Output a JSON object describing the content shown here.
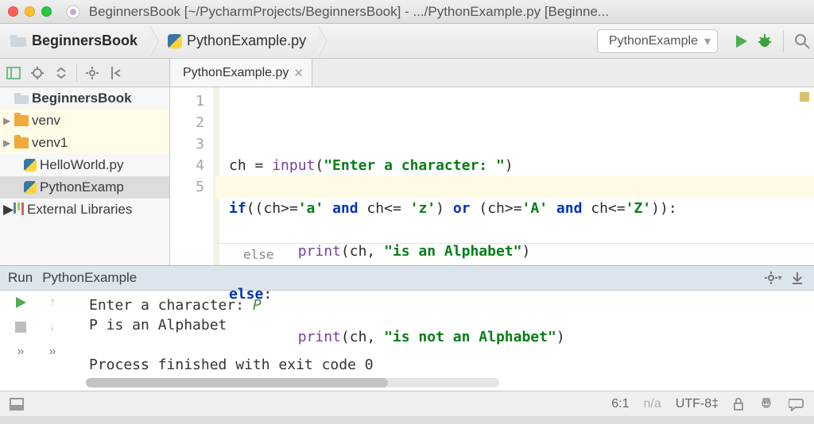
{
  "window": {
    "title": "BeginnersBook [~/PycharmProjects/BeginnersBook] - .../PythonExample.py [Beginne..."
  },
  "breadcrumbs": {
    "root": "BeginnersBook",
    "file": "PythonExample.py"
  },
  "run_config": {
    "name": "PythonExample"
  },
  "tab": {
    "label": "PythonExample.py"
  },
  "tree": {
    "project": "BeginnersBook",
    "items": [
      {
        "label": "venv",
        "kind": "dir"
      },
      {
        "label": "venv1",
        "kind": "dir"
      },
      {
        "label": "HelloWorld.py",
        "kind": "py"
      },
      {
        "label": "PythonExamp",
        "kind": "py",
        "selected": true
      }
    ],
    "external": "External Libraries"
  },
  "editor": {
    "line_numbers": [
      "1",
      "2",
      "3",
      "4",
      "5"
    ],
    "code": {
      "l1_a": "ch = ",
      "l1_fn": "input",
      "l1_b": "(",
      "l1_str": "\"Enter a character: \"",
      "l1_c": ")",
      "l2_kw1": "if",
      "l2_a": "((ch>=",
      "l2_s1": "'a'",
      "l2_b": " ",
      "l2_kw2": "and",
      "l2_c": " ch<= ",
      "l2_s2": "'z'",
      "l2_d": ") ",
      "l2_kw3": "or",
      "l2_e": " (ch>=",
      "l2_s3": "'A'",
      "l2_f": " ",
      "l2_kw4": "and",
      "l2_g": " ch<=",
      "l2_s4": "'Z'",
      "l2_h": ")):",
      "l3_a": "        ",
      "l3_fn": "print",
      "l3_b": "(ch, ",
      "l3_str": "\"is an Alphabet\"",
      "l3_c": ")",
      "l4_kw": "else",
      "l4_a": ":",
      "l5_a": "        ",
      "l5_fn": "print",
      "l5_b": "(ch, ",
      "l5_str": "\"is not an Alphabet\"",
      "l5_c": ")"
    },
    "context": "else"
  },
  "run_panel": {
    "title_prefix": "Run",
    "title": "PythonExample",
    "lines": {
      "prompt": "Enter a character: ",
      "user_input": "P",
      "result": "P is an Alphabet",
      "exit": "Process finished with exit code 0"
    }
  },
  "status": {
    "pos": "6:1",
    "na": "n/a",
    "enc": "UTF-8",
    "enc_suffix": "‡"
  }
}
